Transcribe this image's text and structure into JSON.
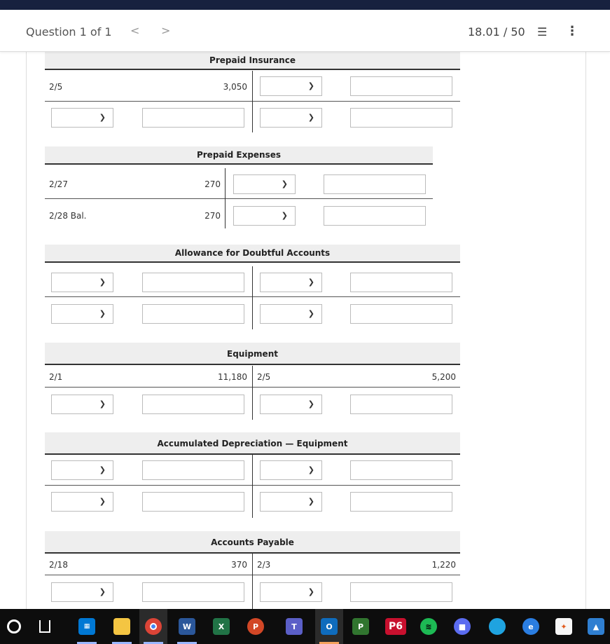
{
  "header": {
    "question_label": "Question 1 of 1",
    "prev": "<",
    "next": ">",
    "score": "18.01 / 50",
    "list_icon": "list-icon",
    "more_icon": "more-icon"
  },
  "accounts": [
    {
      "title": "Prepaid Insurance",
      "rows": [
        {
          "left_label": "2/5",
          "left_value": "3,050",
          "right_label": "",
          "right_value": ""
        },
        {
          "left_label": "",
          "left_value": "",
          "right_label": "",
          "right_value": ""
        }
      ]
    },
    {
      "title": "Prepaid Expenses",
      "rows": [
        {
          "left_label": "2/27",
          "left_value": "270",
          "right_label": "",
          "right_value": ""
        },
        {
          "left_label": "2/28 Bal.",
          "left_value": "270",
          "right_label": "",
          "right_value": ""
        }
      ]
    },
    {
      "title": "Allowance for Doubtful Accounts",
      "rows": [
        {
          "left_label": "",
          "left_value": "",
          "right_label": "",
          "right_value": ""
        },
        {
          "left_label": "",
          "left_value": "",
          "right_label": "",
          "right_value": ""
        }
      ]
    },
    {
      "title": "Equipment",
      "rows": [
        {
          "left_label": "2/1",
          "left_value": "11,180",
          "right_label": "2/5",
          "right_value": "5,200"
        },
        {
          "left_label": "",
          "left_value": "",
          "right_label": "",
          "right_value": ""
        }
      ]
    },
    {
      "title": "Accumulated Depreciation — Equipment",
      "rows": [
        {
          "left_label": "",
          "left_value": "",
          "right_label": "",
          "right_value": ""
        },
        {
          "left_label": "",
          "left_value": "",
          "right_label": "",
          "right_value": ""
        }
      ]
    },
    {
      "title": "Accounts Payable",
      "rows": [
        {
          "left_label": "2/18",
          "left_value": "370",
          "right_label": "2/3",
          "right_value": "1,220"
        },
        {
          "left_label": "",
          "left_value": "",
          "right_label": "",
          "right_value": ""
        }
      ]
    }
  ],
  "taskbar": {
    "items": [
      {
        "name": "start-icon",
        "label": ""
      },
      {
        "name": "task-view-icon",
        "label": ""
      },
      {
        "name": "calendar-icon",
        "label": ""
      },
      {
        "name": "file-explorer-icon",
        "label": ""
      },
      {
        "name": "chrome-icon",
        "label": ""
      },
      {
        "name": "word-icon",
        "label": "W"
      },
      {
        "name": "excel-icon",
        "label": "X"
      },
      {
        "name": "powerpoint-icon",
        "label": "P"
      },
      {
        "name": "teams-icon",
        "label": "T"
      },
      {
        "name": "outlook-icon",
        "label": "O"
      },
      {
        "name": "project-icon",
        "label": "P"
      },
      {
        "name": "p6-icon",
        "label": "P6"
      },
      {
        "name": "spotify-icon",
        "label": ""
      },
      {
        "name": "camera-icon",
        "label": ""
      },
      {
        "name": "edge-icon",
        "label": ""
      },
      {
        "name": "edge-beta-icon",
        "label": ""
      },
      {
        "name": "fox-icon",
        "label": ""
      },
      {
        "name": "photos-icon",
        "label": ""
      }
    ]
  },
  "colors": {
    "topbar": "#17213f",
    "title_bg": "#eeeeee",
    "word": "#2b579a",
    "excel": "#217346",
    "powerpoint": "#d24726",
    "teams": "#5b5fc7",
    "outlook": "#0f6cbd",
    "project": "#31752f",
    "p6": "#c8102e",
    "spotify": "#1db954"
  }
}
